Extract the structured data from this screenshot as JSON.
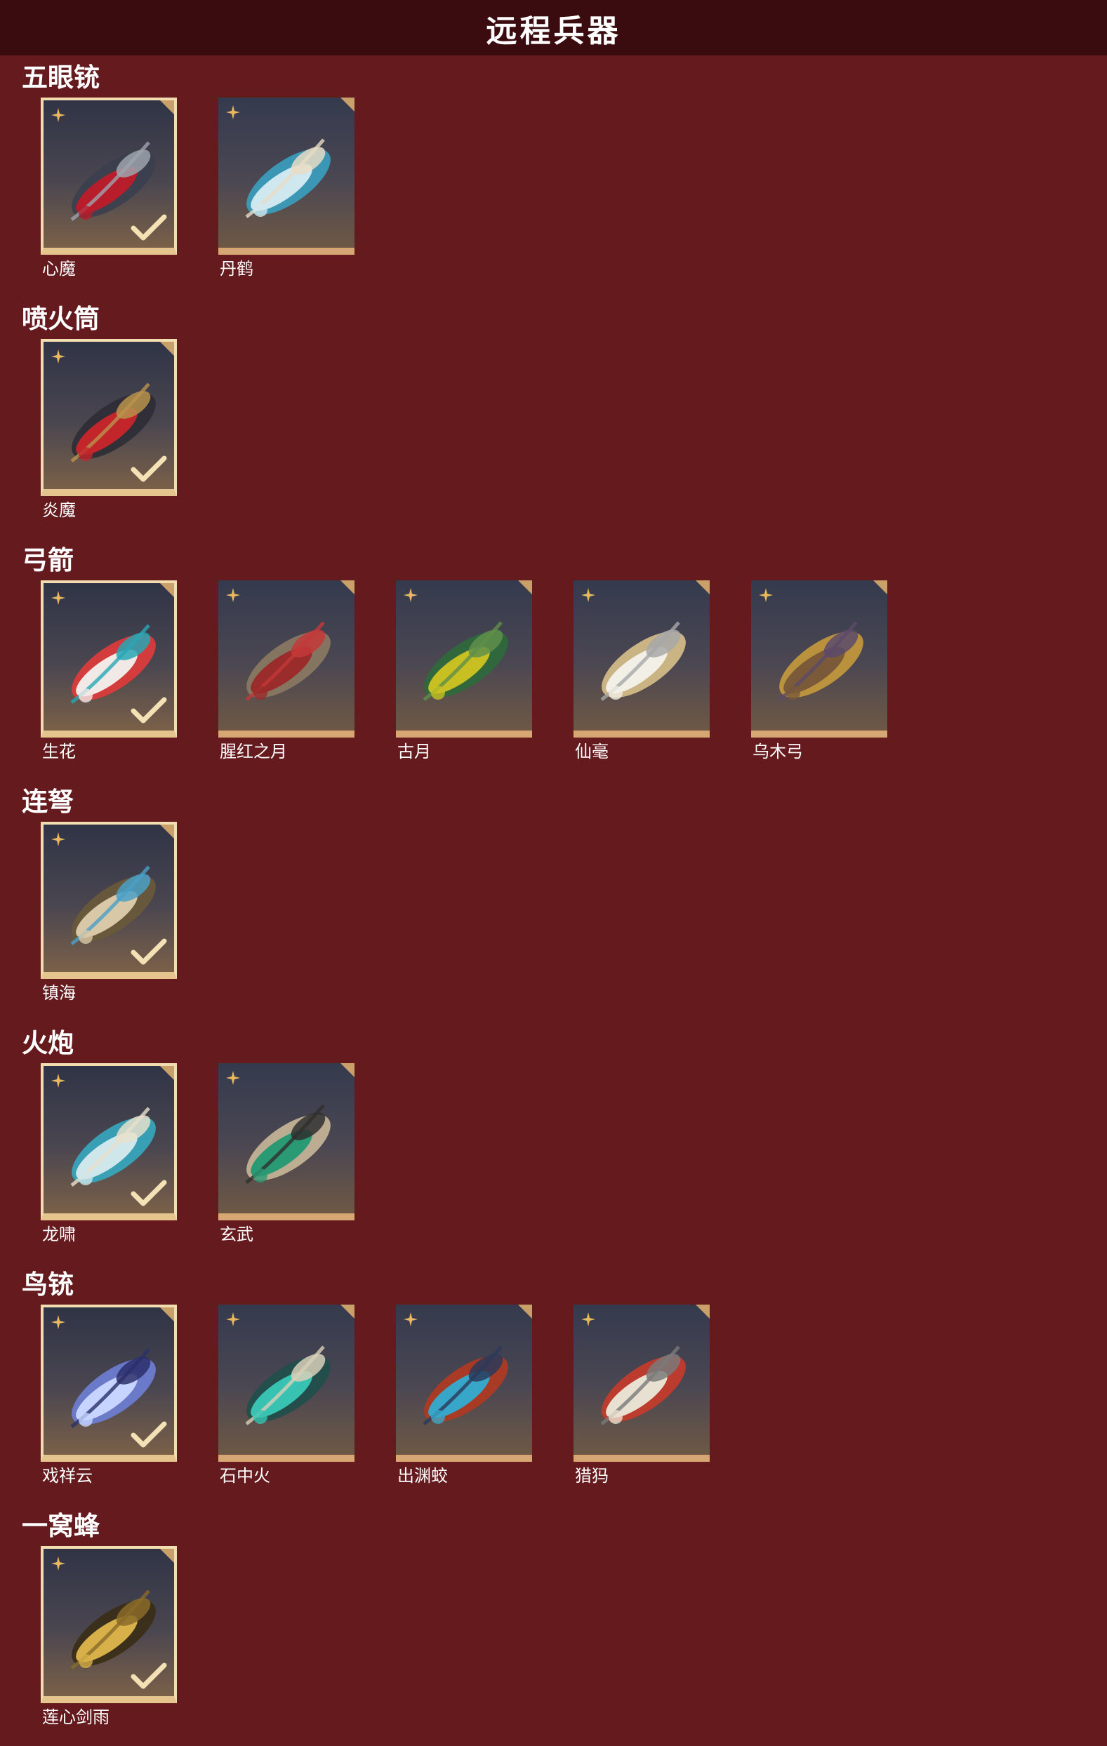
{
  "page": {
    "title": "远程兵器"
  },
  "colors": {
    "background": "#651a1e",
    "header": "#3a0c10",
    "card_border_gold": "#d7a773",
    "rarity_icon": "#e8b85c"
  },
  "rarity_icon_name": "four-point-star-icon",
  "check_icon_name": "checkmark-icon",
  "categories": [
    {
      "title": "五眼铳",
      "items": [
        {
          "name": "心魔",
          "selected": true
        },
        {
          "name": "丹鹤",
          "selected": false
        }
      ]
    },
    {
      "title": "喷火筒",
      "items": [
        {
          "name": "炎魔",
          "selected": true
        }
      ]
    },
    {
      "title": "弓箭",
      "items": [
        {
          "name": "生花",
          "selected": true
        },
        {
          "name": "腥红之月",
          "selected": false
        },
        {
          "name": "古月",
          "selected": false
        },
        {
          "name": "仙毫",
          "selected": false
        },
        {
          "name": "乌木弓",
          "selected": false
        }
      ]
    },
    {
      "title": "连弩",
      "items": [
        {
          "name": "镇海",
          "selected": true
        }
      ]
    },
    {
      "title": "火炮",
      "items": [
        {
          "name": "龙啸",
          "selected": true
        },
        {
          "name": "玄武",
          "selected": false
        }
      ]
    },
    {
      "title": "鸟铳",
      "items": [
        {
          "name": "戏祥云",
          "selected": true
        },
        {
          "name": "石中火",
          "selected": false
        },
        {
          "name": "出渊蛟",
          "selected": false
        },
        {
          "name": "猎犸",
          "selected": false
        }
      ]
    },
    {
      "title": "一窝蜂",
      "items": [
        {
          "name": "莲心剑雨",
          "selected": true
        }
      ]
    }
  ]
}
